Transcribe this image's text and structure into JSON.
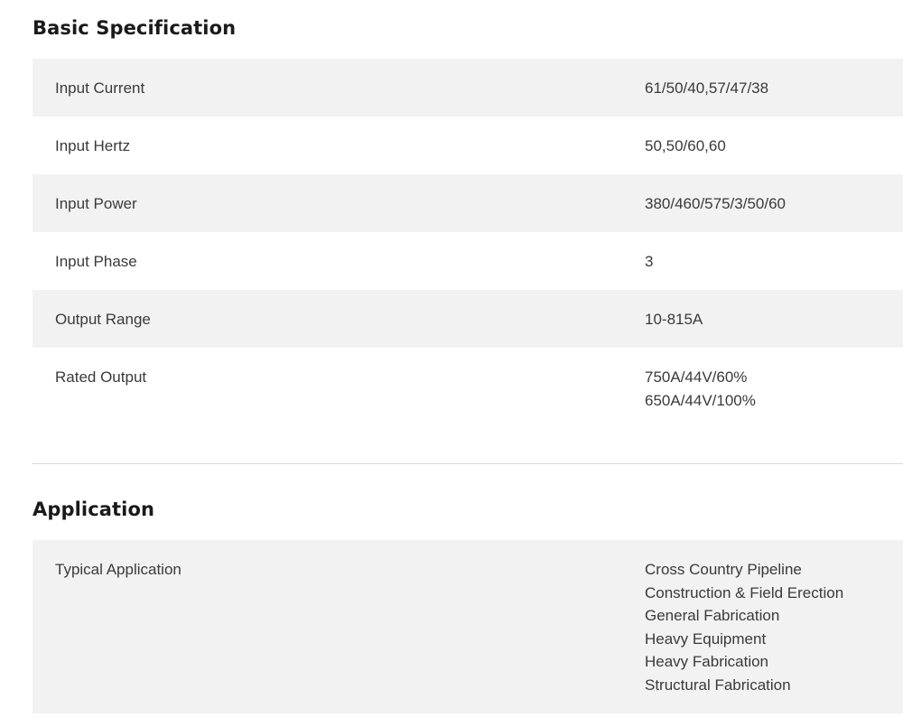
{
  "basic_specification": {
    "title": "Basic Specification",
    "rows": [
      {
        "label": "Input Current",
        "values": [
          "61/50/40,57/47/38"
        ]
      },
      {
        "label": "Input Hertz",
        "values": [
          "50,50/60,60"
        ]
      },
      {
        "label": "Input Power",
        "values": [
          "380/460/575/3/50/60"
        ]
      },
      {
        "label": "Input Phase",
        "values": [
          "3"
        ]
      },
      {
        "label": "Output Range",
        "values": [
          "10-815A"
        ]
      },
      {
        "label": "Rated Output",
        "values": [
          "750A/44V/60%",
          "650A/44V/100%"
        ]
      }
    ]
  },
  "application": {
    "title": "Application",
    "rows": [
      {
        "label": "Typical Application",
        "values": [
          "Cross Country Pipeline",
          "Construction & Field Erection",
          "General Fabrication",
          "Heavy Equipment",
          "Heavy Fabrication",
          "Structural Fabrication"
        ]
      }
    ]
  },
  "colors": {
    "row_shade": "#f2f2f2",
    "divider": "#d6d6d6",
    "heading": "#1a1a1a",
    "text": "#3a3a3a"
  }
}
